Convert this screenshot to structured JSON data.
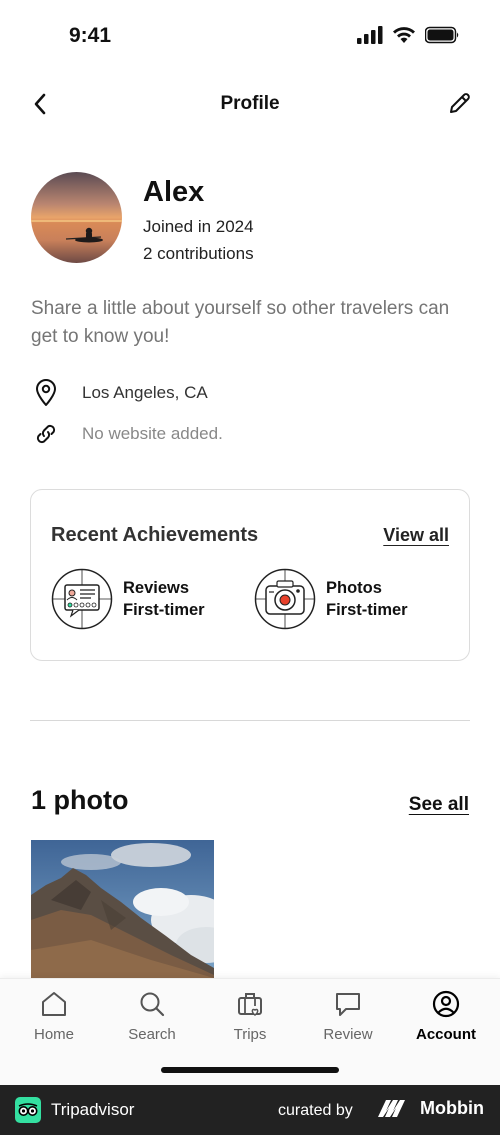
{
  "status_bar": {
    "time": "9:41"
  },
  "header": {
    "title": "Profile"
  },
  "profile": {
    "name": "Alex",
    "joined": "Joined in 2024",
    "contributions": "2 contributions",
    "bio_placeholder": "Share a little about yourself so other travelers can get to know you!",
    "location": "Los Angeles, CA",
    "website": "No website added."
  },
  "achievements": {
    "title": "Recent Achievements",
    "view_all": "View all",
    "items": [
      {
        "line1": "Reviews",
        "line2": "First-timer"
      },
      {
        "line1": "Photos",
        "line2": "First-timer"
      }
    ]
  },
  "photos": {
    "title": "1 photo",
    "see_all": "See all"
  },
  "bottom_nav": {
    "items": [
      {
        "label": "Home",
        "icon": "home-icon"
      },
      {
        "label": "Search",
        "icon": "search-icon"
      },
      {
        "label": "Trips",
        "icon": "trips-icon"
      },
      {
        "label": "Review",
        "icon": "review-icon"
      },
      {
        "label": "Account",
        "icon": "account-icon"
      }
    ],
    "active": "Account"
  },
  "footer": {
    "brand": "Tripadvisor",
    "curated_by": "curated by",
    "curator": "Mobbin"
  },
  "colors": {
    "text": "#111111",
    "muted": "#757575",
    "border": "#dcdcdc",
    "footer_bg": "#222222",
    "badge_red": "#e8412b",
    "tripadvisor_green": "#34e0a1"
  }
}
